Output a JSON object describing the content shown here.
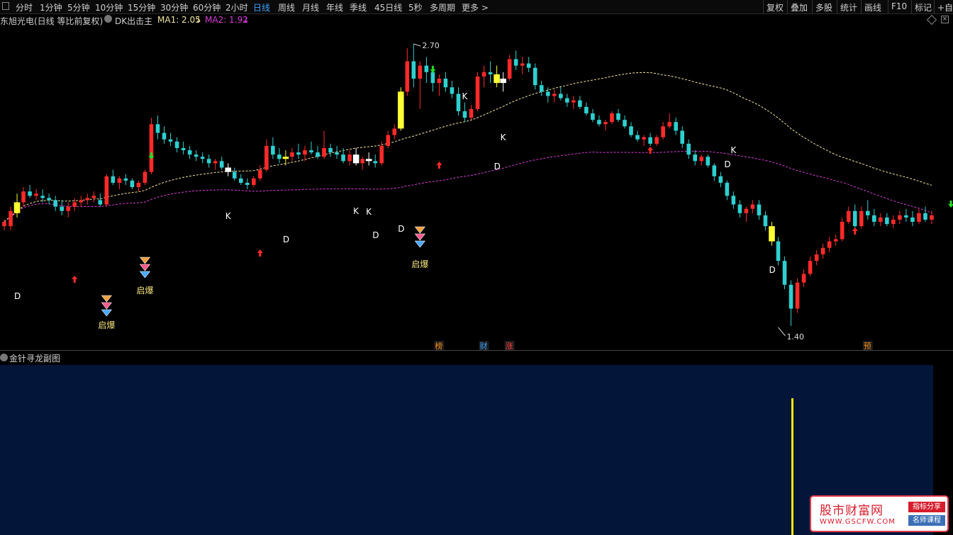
{
  "toolbar": {
    "periods": [
      "分时",
      "1分钟",
      "5分钟",
      "10分钟",
      "15分钟",
      "30分钟",
      "60分钟",
      "2小时",
      "日线",
      "周线",
      "月线",
      "年线",
      "季线",
      "45日线",
      "5秒",
      "多周期",
      "更多 >"
    ],
    "active_period": "日线",
    "tools": [
      "复权",
      "叠加",
      "多股",
      "统计",
      "画线",
      "F10",
      "标记",
      "+自"
    ]
  },
  "legend": {
    "stock": "东旭光电(日线 等比前复权)",
    "indicator": "DK出击主",
    "ma1_label": "MA1: 2.05",
    "ma1_arrow": "↓",
    "ma2_label": "MA2: 1.92",
    "ma2_arrow": "↓"
  },
  "colors": {
    "up": "#ff2a2a",
    "down": "#2fd0d0",
    "ma1": "#f2e6a0",
    "ma2": "#d93cd9",
    "yellow_box": "#ffff33",
    "white_box": "#ffffff",
    "sub_bg": "#03163a"
  },
  "chart_data": {
    "type": "candlestick",
    "price_high_label": "2.70",
    "price_low_label": "1.40",
    "ma_lines": [
      {
        "name": "MA1",
        "value": 2.05
      },
      {
        "name": "MA2",
        "value": 1.92
      }
    ],
    "ohlc": [
      [
        1.86,
        1.89,
        1.84,
        1.88
      ],
      [
        1.86,
        1.95,
        1.84,
        1.93
      ],
      [
        1.92,
        2.01,
        1.9,
        1.97
      ],
      [
        1.97,
        2.04,
        1.95,
        2.02
      ],
      [
        2.02,
        2.05,
        1.99,
        2.0
      ],
      [
        2.0,
        2.03,
        1.98,
        2.01
      ],
      [
        2.0,
        2.03,
        1.97,
        1.99
      ],
      [
        1.99,
        2.01,
        1.96,
        1.98
      ],
      [
        1.98,
        2.0,
        1.93,
        1.95
      ],
      [
        1.95,
        1.98,
        1.91,
        1.93
      ],
      [
        1.93,
        1.97,
        1.9,
        1.95
      ],
      [
        1.95,
        1.99,
        1.93,
        1.97
      ],
      [
        1.97,
        2.0,
        1.95,
        1.98
      ],
      [
        1.98,
        2.01,
        1.96,
        1.99
      ],
      [
        1.99,
        2.02,
        1.97,
        2.0
      ],
      [
        1.98,
        2.01,
        1.95,
        1.96
      ],
      [
        1.96,
        2.1,
        1.95,
        2.09
      ],
      [
        2.09,
        2.12,
        2.05,
        2.06
      ],
      [
        2.06,
        2.09,
        2.03,
        2.08
      ],
      [
        2.08,
        2.1,
        2.05,
        2.07
      ],
      [
        2.07,
        2.08,
        2.03,
        2.04
      ],
      [
        2.04,
        2.07,
        2.02,
        2.06
      ],
      [
        2.06,
        2.12,
        2.05,
        2.11
      ],
      [
        2.11,
        2.36,
        2.1,
        2.33
      ],
      [
        2.33,
        2.37,
        2.26,
        2.29
      ],
      [
        2.29,
        2.32,
        2.24,
        2.26
      ],
      [
        2.26,
        2.29,
        2.23,
        2.25
      ],
      [
        2.25,
        2.27,
        2.2,
        2.22
      ],
      [
        2.22,
        2.25,
        2.19,
        2.21
      ],
      [
        2.21,
        2.23,
        2.17,
        2.19
      ],
      [
        2.19,
        2.21,
        2.16,
        2.18
      ],
      [
        2.18,
        2.2,
        2.15,
        2.17
      ],
      [
        2.17,
        2.19,
        2.13,
        2.15
      ],
      [
        2.15,
        2.17,
        2.12,
        2.16
      ],
      [
        2.16,
        2.18,
        2.12,
        2.13
      ],
      [
        2.13,
        2.15,
        2.09,
        2.11
      ],
      [
        2.11,
        2.13,
        2.07,
        2.08
      ],
      [
        2.08,
        2.1,
        2.05,
        2.06
      ],
      [
        2.06,
        2.08,
        2.03,
        2.05
      ],
      [
        2.05,
        2.09,
        2.04,
        2.08
      ],
      [
        2.08,
        2.14,
        2.07,
        2.12
      ],
      [
        2.12,
        2.26,
        2.11,
        2.23
      ],
      [
        2.23,
        2.27,
        2.17,
        2.19
      ],
      [
        2.19,
        2.22,
        2.15,
        2.17
      ],
      [
        2.17,
        2.21,
        2.14,
        2.18
      ],
      [
        2.18,
        2.22,
        2.16,
        2.2
      ],
      [
        2.2,
        2.24,
        2.17,
        2.19
      ],
      [
        2.19,
        2.23,
        2.16,
        2.21
      ],
      [
        2.21,
        2.25,
        2.19,
        2.2
      ],
      [
        2.2,
        2.23,
        2.17,
        2.18
      ],
      [
        2.18,
        2.3,
        2.17,
        2.22
      ],
      [
        2.22,
        2.24,
        2.18,
        2.2
      ],
      [
        2.2,
        2.23,
        2.17,
        2.19
      ],
      [
        2.19,
        2.22,
        2.15,
        2.16
      ],
      [
        2.16,
        2.21,
        2.14,
        2.19
      ],
      [
        2.19,
        2.22,
        2.14,
        2.15
      ],
      [
        2.15,
        2.18,
        2.12,
        2.17
      ],
      [
        2.17,
        2.2,
        2.14,
        2.16
      ],
      [
        2.16,
        2.19,
        2.13,
        2.15
      ],
      [
        2.15,
        2.25,
        2.14,
        2.23
      ],
      [
        2.23,
        2.3,
        2.22,
        2.28
      ],
      [
        2.28,
        2.33,
        2.26,
        2.31
      ],
      [
        2.31,
        2.5,
        2.3,
        2.48
      ],
      [
        2.48,
        2.68,
        2.46,
        2.62
      ],
      [
        2.62,
        2.7,
        2.5,
        2.54
      ],
      [
        2.54,
        2.62,
        2.4,
        2.6
      ],
      [
        2.6,
        2.64,
        2.52,
        2.57
      ],
      [
        2.57,
        2.6,
        2.48,
        2.52
      ],
      [
        2.52,
        2.56,
        2.46,
        2.54
      ],
      [
        2.54,
        2.57,
        2.48,
        2.5
      ],
      [
        2.5,
        2.53,
        2.45,
        2.47
      ],
      [
        2.47,
        2.5,
        2.37,
        2.39
      ],
      [
        2.39,
        2.43,
        2.34,
        2.36
      ],
      [
        2.36,
        2.42,
        2.35,
        2.4
      ],
      [
        2.4,
        2.57,
        2.39,
        2.55
      ],
      [
        2.55,
        2.6,
        2.5,
        2.57
      ],
      [
        2.57,
        2.62,
        2.52,
        2.56
      ],
      [
        2.56,
        2.6,
        2.5,
        2.52
      ],
      [
        2.52,
        2.57,
        2.48,
        2.54
      ],
      [
        2.54,
        2.65,
        2.53,
        2.63
      ],
      [
        2.63,
        2.67,
        2.58,
        2.6
      ],
      [
        2.6,
        2.64,
        2.56,
        2.61
      ],
      [
        2.61,
        2.64,
        2.57,
        2.59
      ],
      [
        2.59,
        2.61,
        2.49,
        2.51
      ],
      [
        2.51,
        2.53,
        2.46,
        2.48
      ],
      [
        2.48,
        2.5,
        2.43,
        2.46
      ],
      [
        2.46,
        2.49,
        2.43,
        2.47
      ],
      [
        2.47,
        2.5,
        2.44,
        2.45
      ],
      [
        2.45,
        2.47,
        2.41,
        2.43
      ],
      [
        2.43,
        2.46,
        2.4,
        2.44
      ],
      [
        2.44,
        2.46,
        2.4,
        2.41
      ],
      [
        2.41,
        2.43,
        2.37,
        2.38
      ],
      [
        2.38,
        2.4,
        2.34,
        2.35
      ],
      [
        2.35,
        2.37,
        2.32,
        2.33
      ],
      [
        2.33,
        2.35,
        2.3,
        2.34
      ],
      [
        2.34,
        2.39,
        2.33,
        2.38
      ],
      [
        2.38,
        2.4,
        2.34,
        2.35
      ],
      [
        2.35,
        2.37,
        2.31,
        2.32
      ],
      [
        2.32,
        2.34,
        2.27,
        2.28
      ],
      [
        2.28,
        2.3,
        2.25,
        2.26
      ],
      [
        2.26,
        2.28,
        2.23,
        2.27
      ],
      [
        2.27,
        2.29,
        2.23,
        2.24
      ],
      [
        2.24,
        2.28,
        2.23,
        2.27
      ],
      [
        2.27,
        2.34,
        2.26,
        2.32
      ],
      [
        2.32,
        2.38,
        2.31,
        2.34
      ],
      [
        2.34,
        2.36,
        2.28,
        2.3
      ],
      [
        2.3,
        2.32,
        2.22,
        2.24
      ],
      [
        2.24,
        2.26,
        2.17,
        2.19
      ],
      [
        2.19,
        2.21,
        2.14,
        2.16
      ],
      [
        2.16,
        2.19,
        2.14,
        2.18
      ],
      [
        2.18,
        2.19,
        2.13,
        2.14
      ],
      [
        2.14,
        2.15,
        2.07,
        2.09
      ],
      [
        2.09,
        2.11,
        2.04,
        2.06
      ],
      [
        2.06,
        2.07,
        1.98,
        2.0
      ],
      [
        2.0,
        2.02,
        1.94,
        1.96
      ],
      [
        1.96,
        1.98,
        1.9,
        1.92
      ],
      [
        1.92,
        1.95,
        1.88,
        1.94
      ],
      [
        1.94,
        1.98,
        1.92,
        1.96
      ],
      [
        1.96,
        1.98,
        1.89,
        1.91
      ],
      [
        1.91,
        1.93,
        1.84,
        1.86
      ],
      [
        1.86,
        1.88,
        1.77,
        1.79
      ],
      [
        1.79,
        1.81,
        1.68,
        1.7
      ],
      [
        1.7,
        1.72,
        1.57,
        1.59
      ],
      [
        1.59,
        1.61,
        1.4,
        1.48
      ],
      [
        1.48,
        1.62,
        1.46,
        1.6
      ],
      [
        1.6,
        1.66,
        1.58,
        1.64
      ],
      [
        1.64,
        1.72,
        1.63,
        1.7
      ],
      [
        1.7,
        1.75,
        1.68,
        1.73
      ],
      [
        1.73,
        1.78,
        1.71,
        1.76
      ],
      [
        1.76,
        1.81,
        1.74,
        1.79
      ],
      [
        1.79,
        1.82,
        1.77,
        1.8
      ],
      [
        1.8,
        1.9,
        1.79,
        1.88
      ],
      [
        1.88,
        1.95,
        1.87,
        1.93
      ],
      [
        1.93,
        1.96,
        1.84,
        1.86
      ],
      [
        1.86,
        1.95,
        1.85,
        1.93
      ],
      [
        1.93,
        1.98,
        1.89,
        1.91
      ],
      [
        1.91,
        1.94,
        1.86,
        1.88
      ],
      [
        1.88,
        1.92,
        1.86,
        1.9
      ],
      [
        1.9,
        1.92,
        1.86,
        1.87
      ],
      [
        1.87,
        1.91,
        1.85,
        1.89
      ],
      [
        1.89,
        1.93,
        1.87,
        1.91
      ],
      [
        1.91,
        1.94,
        1.88,
        1.9
      ],
      [
        1.9,
        1.93,
        1.86,
        1.88
      ],
      [
        1.88,
        1.94,
        1.87,
        1.92
      ],
      [
        1.92,
        1.95,
        1.88,
        1.89
      ],
      [
        1.89,
        1.93,
        1.87,
        1.91
      ]
    ],
    "ma1_values_fraction": "smooth rising dashed line from 1.92 to 2.05",
    "markers": {
      "K": "K",
      "D": "D",
      "qibao": "启爆",
      "bottom_tags": [
        "榜",
        "财",
        "涨",
        "预"
      ]
    }
  },
  "sub_panel": {
    "title": "金针寻龙副图"
  },
  "watermark": {
    "main": "股市财富网",
    "url": "WWW.GSCFW.COM",
    "tag1": "指标分享",
    "tag2": "名师课程"
  }
}
